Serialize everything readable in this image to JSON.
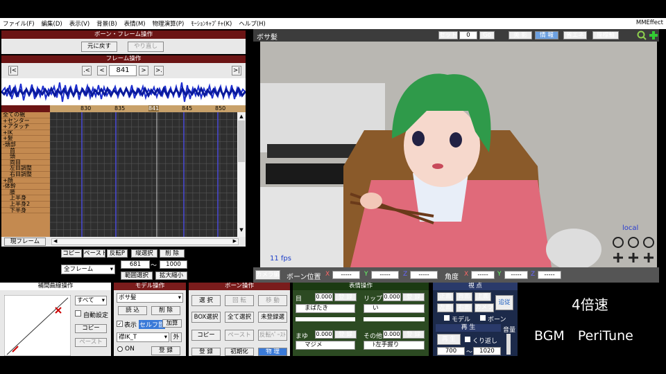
{
  "menu": [
    "ファイル(F)",
    "編集(D)",
    "表示(V)",
    "背景(B)",
    "表情(M)",
    "物理演算(P)",
    "ﾓｰｼｮﾝｷｬﾌﾟﾁｬ(K)",
    "ヘルプ(H)"
  ],
  "menu_right": "MMEffect",
  "boneframe": {
    "title": "ボーン・フレーム操作",
    "undo": "元に戻す",
    "redo": "やり直し"
  },
  "frameop": {
    "title": "フレーム操作",
    "prev_key": ".<",
    "prev": "<",
    "frame": "841",
    "next": ">",
    "next_key": ">.",
    "first": "|<",
    "last": ">|"
  },
  "ruler_ticks": [
    "830",
    "835",
    "841",
    "845",
    "850"
  ],
  "bones": [
    {
      "label": "全ての親",
      "indent": false
    },
    {
      "label": "+センター",
      "indent": false
    },
    {
      "label": "+アタッチ",
      "indent": false
    },
    {
      "label": "+IK",
      "indent": false
    },
    {
      "label": "+髪",
      "indent": false
    },
    {
      "label": "-頭部",
      "indent": false
    },
    {
      "label": "首",
      "indent": true
    },
    {
      "label": "頭",
      "indent": true
    },
    {
      "label": "両目",
      "indent": true
    },
    {
      "label": "左目調整",
      "indent": true
    },
    {
      "label": "右目調整",
      "indent": true
    },
    {
      "label": "+顔",
      "indent": false
    },
    {
      "label": "-体幹",
      "indent": false
    },
    {
      "label": "腰",
      "indent": true
    },
    {
      "label": "上半身",
      "indent": true
    },
    {
      "label": "上半身2",
      "indent": true
    },
    {
      "label": "下半身",
      "indent": true
    }
  ],
  "current_frame_btn": "現フレーム",
  "ctrl": {
    "copy": "コピー",
    "paste": "ペースト",
    "reverse": "反転P",
    "vsel": "縦選択",
    "delete": "削 除",
    "all_frames": "全フレーム",
    "range_from": "681",
    "tilde": "〜",
    "range_to": "1000",
    "range_select": "範囲選択",
    "scale": "拡大縮小"
  },
  "viewport": {
    "title": "ボサ髪",
    "set": "セット",
    "set_val": "0",
    "go": "Go",
    "beauty": "美 影",
    "info": "情 報",
    "eco": "省エネ",
    "axis": "座標軸",
    "fps": "11 fps",
    "local": "local"
  },
  "camera": {
    "tab": "カメラ編",
    "bonepos": "ボーン位置",
    "x": "X",
    "y": "Y",
    "z": "Z",
    "angle": "角度",
    "dashes": "-----"
  },
  "interp": {
    "title": "補間曲線操作",
    "all": "すべて",
    "auto": "自動設定",
    "copy": "コピー",
    "paste": "ペースト"
  },
  "modelop": {
    "title": "モデル操作",
    "model": "ボサ髪",
    "load": "読 込",
    "delete": "削 除",
    "show": "表示",
    "self": "セルフ影",
    "add": "加算",
    "ik": "襟IK_T",
    "ext": "外",
    "on": "ON",
    "register": "登 録"
  },
  "boneop2": {
    "title": "ボーン操作",
    "select": "選 択",
    "rotate": "回 転",
    "move": "移 動",
    "boxsel": "BOX選択",
    "allsel": "全て選択",
    "unreg": "未登録選",
    "copy": "コピー",
    "paste": "ペースト",
    "revpaste": "反転ﾍﾟｰｽﾄ",
    "register": "登 録",
    "init": "初期化",
    "physics": "物 理"
  },
  "exprop": {
    "title": "表情操作",
    "eye": "目",
    "lip": "リップ",
    "brow": "まゆ",
    "other": "その他",
    "val": "0.000",
    "reg": "登 録",
    "eye_sel": "まばたき",
    "lip_sel": "い",
    "brow_sel": "マジメ",
    "other_sel": "ﾄ左手握り"
  },
  "viewop": {
    "title": "視 点",
    "front": "正面",
    "back": "背面",
    "top": "上面",
    "left": "左面",
    "right": "右面",
    "camera": "カメラ",
    "follow": "追従",
    "model": "モデル",
    "bone": "ボーン",
    "play_title": "再 生",
    "play": "再 生",
    "repeat": "くり返し",
    "from": "700",
    "to": "1020",
    "vol": "音量"
  },
  "overlay": {
    "speed": "4倍速",
    "bgm": "BGM　PeriTune"
  }
}
